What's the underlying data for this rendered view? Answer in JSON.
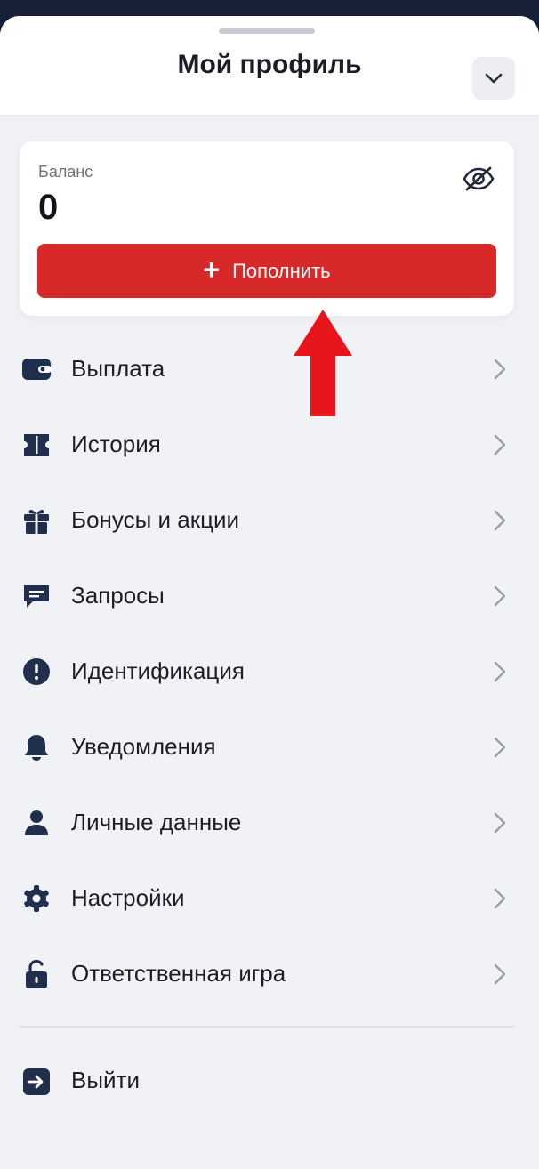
{
  "header": {
    "title": "Мой профиль"
  },
  "balance": {
    "label": "Баланс",
    "value": "0",
    "topup_label": "Пополнить",
    "topup_color": "#d7292a"
  },
  "menu": {
    "items": [
      {
        "label": "Выплата",
        "icon": "wallet-icon"
      },
      {
        "label": "История",
        "icon": "ticket-icon"
      },
      {
        "label": "Бонусы и акции",
        "icon": "gift-icon"
      },
      {
        "label": "Запросы",
        "icon": "chat-icon"
      },
      {
        "label": "Идентификация",
        "icon": "alert-circle-icon"
      },
      {
        "label": "Уведомления",
        "icon": "bell-icon"
      },
      {
        "label": "Личные данные",
        "icon": "user-icon"
      },
      {
        "label": "Настройки",
        "icon": "gear-icon"
      },
      {
        "label": "Ответственная игра",
        "icon": "unlock-icon"
      }
    ],
    "logout_label": "Выйти"
  },
  "colors": {
    "icon": "#1f2f4d",
    "accent": "#d7292a",
    "annotation_arrow": "#e8161c"
  }
}
